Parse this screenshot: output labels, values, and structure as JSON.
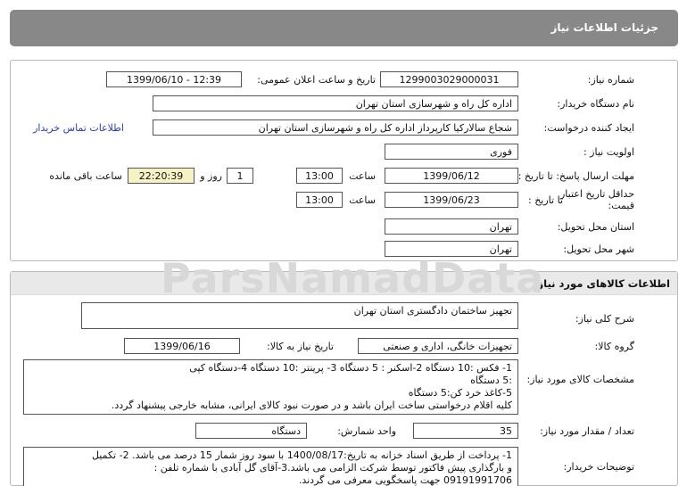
{
  "header": {
    "title": "جزئیات اطلاعات نیاز"
  },
  "watermark": "ParsNamadData",
  "info": {
    "need_number_label": "شماره نیاز:",
    "need_number": "1299003029000031",
    "announce_label": "تاریخ و ساعت اعلان عمومی:",
    "announce_value": "1399/06/10 - 12:39",
    "buyer_label": "نام دستگاه خریدار:",
    "buyer_value": "اداره کل راه و شهرسازی استان تهران",
    "creator_label": "ایجاد کننده درخواست:",
    "creator_value": "شجاع سالارکیا کارپرداز اداره کل راه و شهرسازی استان تهران",
    "contact_link": "اطلاعات تماس خریدار",
    "priority_label": "اولویت نیاز :",
    "priority_value": "فوری",
    "deadline_label": "مهلت ارسال پاسخ: تا تاریخ :",
    "deadline_date": "1399/06/12",
    "time_label": "ساعت",
    "deadline_time": "13:00",
    "days_value": "1",
    "days_label": "روز و",
    "remaining_time": "22:20:39",
    "remaining_label": "ساعت باقی مانده",
    "validity_label_1": "حداقل تاریخ اعتبار",
    "validity_label_2": "قیمت:",
    "validity_to_label": "تا تاریخ :",
    "validity_date": "1399/06/23",
    "validity_time": "13:00",
    "province_label": "استان محل تحویل:",
    "province_value": "تهران",
    "city_label": "شهر محل تحویل:",
    "city_value": "تهران"
  },
  "goods": {
    "section_title": "اطلاعات کالاهای مورد نیاز",
    "desc_label": "شرح کلی نیاز:",
    "desc_value": "تجهیز ساختمان دادگستری استان تهران",
    "group_label": "گروه کالا:",
    "group_value": "تجهیزات خانگی، اداری و صنعتی",
    "need_date_label": "تاریخ نیاز به کالا:",
    "need_date_value": "1399/06/16",
    "spec_label": "مشخصات کالای مورد نیاز:",
    "spec_lines": [
      "1- فکس  :10 دستگاه    2-اسکنر : 5 دستگاه       3- پرینتر :10 دستگاه              4-دستگاه کپی",
      ":5 دستگاه",
      "5-کاغذ خرد کن:5 دستگاه",
      "کلیه اقلام درخواستی ساخت ایران باشد و در صورت نبود کالای ایرانی، مشابه خارجی پیشنهاد گردد."
    ],
    "qty_label": "تعداد / مقدار مورد نیاز:",
    "qty_value": "35",
    "unit_label": "واحد شمارش:",
    "unit_value": "دستگاه",
    "notes_label": "توضیحات خریدار:",
    "notes_lines": [
      "1- پرداخت از طریق اسناد خزانه به تاریخ:1400/08/17 با سود روز شمار 15 درصد می باشد. 2- تکمیل",
      "و بارگذاری پیش فاکتور توسط شرکت الزامی می باشد.3-آقای گل آبادی با شماره تلفن :",
      "09191991706 جهت پاسخگویی معرفی می گردند."
    ]
  }
}
